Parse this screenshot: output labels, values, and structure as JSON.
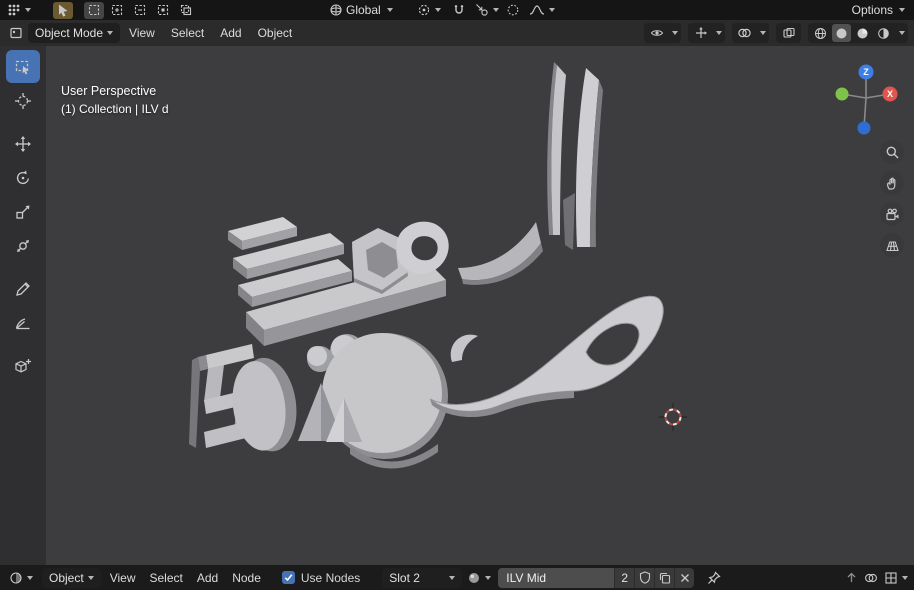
{
  "topbar": {
    "orientation_label": "Global",
    "options_label": "Options"
  },
  "vp_header": {
    "mode_label": "Object Mode",
    "menu_view": "View",
    "menu_select": "Select",
    "menu_add": "Add",
    "menu_object": "Object"
  },
  "viewport": {
    "overlay_line1": "User Perspective",
    "overlay_line2": "(1) Collection | ILV d",
    "gizmo_z": "Z",
    "gizmo_x": "X"
  },
  "bottombar": {
    "mode_label": "Object",
    "menu_view": "View",
    "menu_select": "Select",
    "menu_add": "Add",
    "menu_node": "Node",
    "use_nodes_label": "Use Nodes",
    "slot_label": "Slot 2",
    "material_name": "ILV Mid",
    "material_users": "2"
  },
  "colors": {
    "accent": "#4772b3",
    "axis_x": "#e0564e",
    "axis_y": "#7fc24a",
    "axis_z": "#3d7fe8",
    "viewport_bg": "#3d3d3f",
    "topbar_bg": "#151515"
  },
  "icon_names": [
    "app-menu-icon",
    "active-tool-icon",
    "select-mode-icons",
    "orientation-globe-icon",
    "pivot-icon",
    "snap-magnet-icon",
    "snap-target-icon",
    "proportional-circle-icon",
    "falloff-curve-icon",
    "editor-type-icon",
    "eye-icon",
    "gizmo-icon",
    "overlays-icon",
    "xray-icon",
    "shading-wireframe-icon",
    "shading-solid-icon",
    "shading-material-icon",
    "shading-rendered-icon",
    "box-select-icon",
    "cursor-tool-icon",
    "move-icon",
    "rotate-icon",
    "scale-icon",
    "transform-icon",
    "annotate-icon",
    "measure-icon",
    "add-cube-icon",
    "zoom-icon",
    "hand-icon",
    "camera-icon",
    "grid-icon",
    "shader-editor-icon",
    "material-sphere-icon",
    "shield-icon",
    "copy-icon",
    "close-icon",
    "pin-icon",
    "arrow-up-icon",
    "render-icon",
    "snap-grid-icon"
  ]
}
